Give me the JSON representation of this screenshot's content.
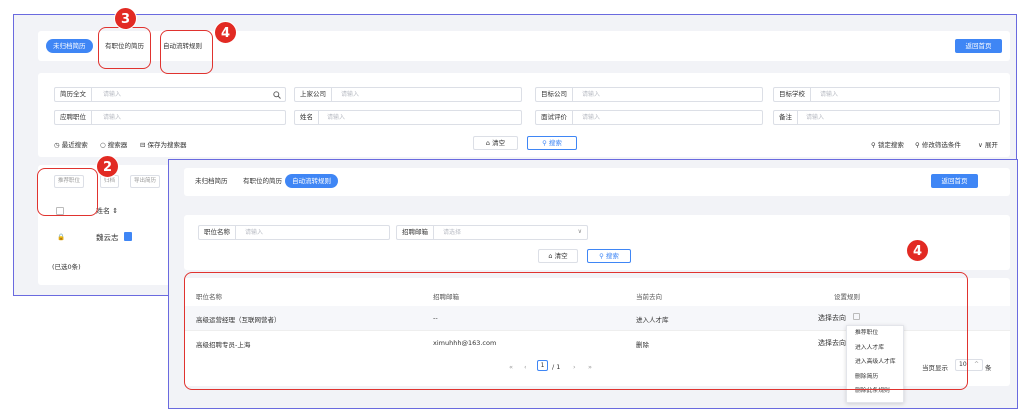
{
  "back": {
    "tabs": [
      "未归档简历",
      "有职位的简历",
      "自动流转规则"
    ],
    "return_button": "返回首页",
    "fields": [
      {
        "label": "简历全文",
        "placeholder": "请输入"
      },
      {
        "label": "上家公司",
        "placeholder": "请输入"
      },
      {
        "label": "目标公司",
        "placeholder": "请输入"
      },
      {
        "label": "目标学校",
        "placeholder": "请输入"
      },
      {
        "label": "应聘职位",
        "placeholder": "请输入"
      },
      {
        "label": "姓名",
        "placeholder": "请输入"
      },
      {
        "label": "面试评价",
        "placeholder": "请输入"
      },
      {
        "label": "备注",
        "placeholder": "请输入"
      }
    ],
    "recent_search": "最近搜索",
    "search_tool": "搜索器",
    "save_search": "保存为搜索器",
    "clear": "清空",
    "search": "搜索",
    "lock_search": "锁定搜索",
    "edit_filter": "修改筛选条件",
    "expand": "展开",
    "action_buttons": [
      "推荐职位",
      "归档",
      "导出简历"
    ],
    "col_name": "姓名",
    "row_name": "魏云志",
    "selected": "(已选0条)"
  },
  "front": {
    "tabs": [
      "未归档简历",
      "有职位的简历",
      "自动流转规则"
    ],
    "return_button": "返回首页",
    "job_name_label": "职位名称",
    "job_name_placeholder": "请输入",
    "email_label": "招聘邮箱",
    "email_placeholder": "请选择",
    "clear": "清空",
    "search": "搜索",
    "columns": [
      "职位名称",
      "招聘邮箱",
      "当前去向",
      "设置规则"
    ],
    "rows": [
      {
        "job": "高级运营经理（互联网营者）",
        "email": "--",
        "dest": "进入人才库",
        "rule": "选择去向"
      },
      {
        "job": "高级招聘专员-上海",
        "email": "ximuhhh@163.com",
        "dest": "删除",
        "rule": "选择去向"
      }
    ],
    "pagination": {
      "current": "1",
      "total": "/ 1"
    },
    "page_size_label": "当页显示",
    "page_size": "10",
    "page_size_unit": "条",
    "menu": [
      "推荐职位",
      "进入人才库",
      "进入高级人才库",
      "删除简历",
      "删除此条规则"
    ]
  },
  "badges": [
    "3",
    "4",
    "2",
    "4"
  ]
}
